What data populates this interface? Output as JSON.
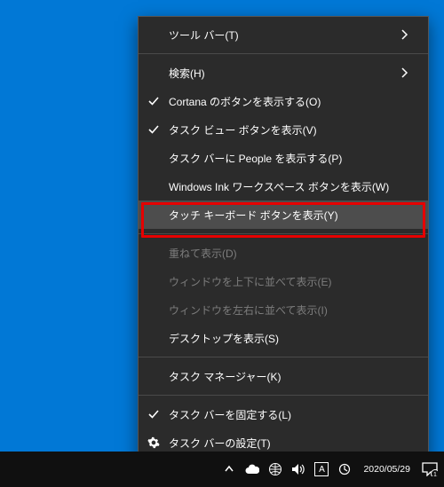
{
  "menu": {
    "toolbars": {
      "label": "ツール バー(T)"
    },
    "search": {
      "label": "検索(H)"
    },
    "cortana": {
      "label": "Cortana のボタンを表示する(O)",
      "checked": true
    },
    "taskview": {
      "label": "タスク ビュー ボタンを表示(V)",
      "checked": true
    },
    "people": {
      "label": "タスク バーに People を表示する(P)"
    },
    "ink": {
      "label": "Windows Ink ワークスペース ボタンを表示(W)"
    },
    "touchkb": {
      "label": "タッチ キーボード ボタンを表示(Y)"
    },
    "cascade": {
      "label": "重ねて表示(D)"
    },
    "stackv": {
      "label": "ウィンドウを上下に並べて表示(E)"
    },
    "stackh": {
      "label": "ウィンドウを左右に並べて表示(I)"
    },
    "showdesk": {
      "label": "デスクトップを表示(S)"
    },
    "taskmgr": {
      "label": "タスク マネージャー(K)"
    },
    "lock": {
      "label": "タスク バーを固定する(L)",
      "checked": true
    },
    "settings": {
      "label": "タスク バーの設定(T)"
    }
  },
  "taskbar": {
    "ime_mode": "A",
    "clock": {
      "time": "",
      "date": "2020/05/29"
    },
    "notification_count": "1"
  }
}
